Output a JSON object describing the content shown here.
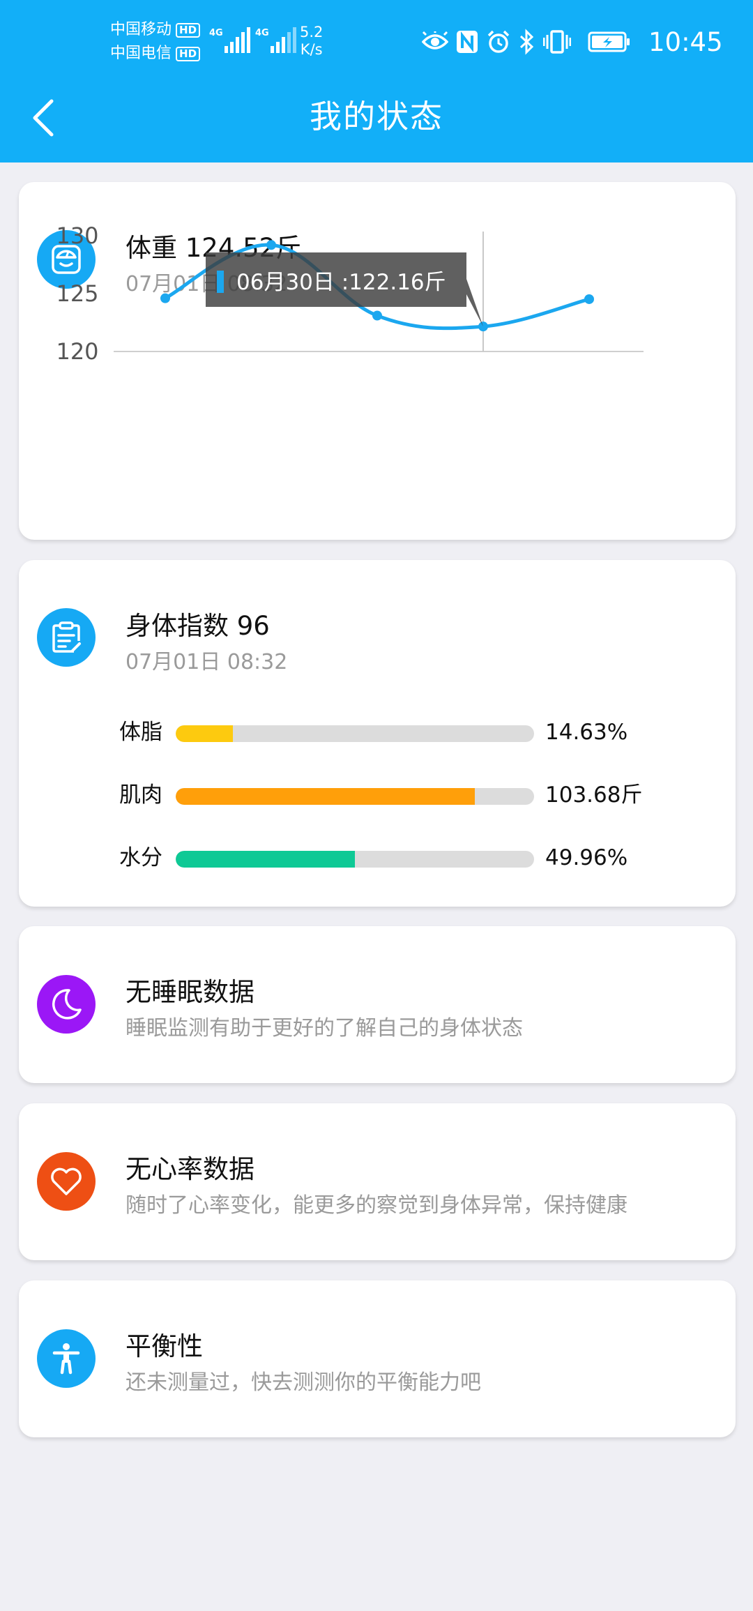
{
  "status_bar": {
    "carrier1": "中国移动",
    "carrier2": "中国电信",
    "hd": "HD",
    "net1": "4G",
    "net2": "4G",
    "speed_value": "5.2",
    "speed_unit": "K/s",
    "time": "10:45"
  },
  "header": {
    "title": "我的状态"
  },
  "weight_card": {
    "title": "体重 124.52斤",
    "date": "07月01日 08:32",
    "tooltip": "06月30日 :122.16斤",
    "colors": {
      "line": "#1ba7ef",
      "tooltip_bg": "#3d3d3d",
      "tooltip_marker": "#1ba7ef"
    }
  },
  "chart_data": {
    "type": "line",
    "title": "",
    "xlabel": "",
    "ylabel": "",
    "x": [
      1,
      2,
      3,
      4,
      5
    ],
    "values": [
      124.6,
      129.2,
      123.1,
      122.16,
      124.52
    ],
    "ylim": [
      120,
      130
    ],
    "yticks": [
      "130",
      "125",
      "120"
    ],
    "grid": false,
    "highlight_index": 3
  },
  "body_index_card": {
    "title": "身体指数 96",
    "date": "07月01日 08:32",
    "bars": [
      {
        "label": "体脂",
        "value": "14.63%",
        "fill": 0.16,
        "color": "#fdca0f"
      },
      {
        "label": "肌肉",
        "value": "103.68斤",
        "fill": 0.835,
        "color": "#ff9f0a"
      },
      {
        "label": "水分",
        "value": "49.96%",
        "fill": 0.5,
        "color": "#0ec995"
      }
    ]
  },
  "sleep_card": {
    "title": "无睡眠数据",
    "subtitle": "睡眠监测有助于更好的了解自己的身体状态",
    "color": "#9b17f6"
  },
  "heart_card": {
    "title": "无心率数据",
    "subtitle": "随时了心率变化，能更多的察觉到身体异常，保持健康",
    "color": "#ee4f14"
  },
  "balance_card": {
    "title": "平衡性",
    "subtitle": "还未测量过，快去测测你的平衡能力吧",
    "color": "#16a9f4"
  }
}
